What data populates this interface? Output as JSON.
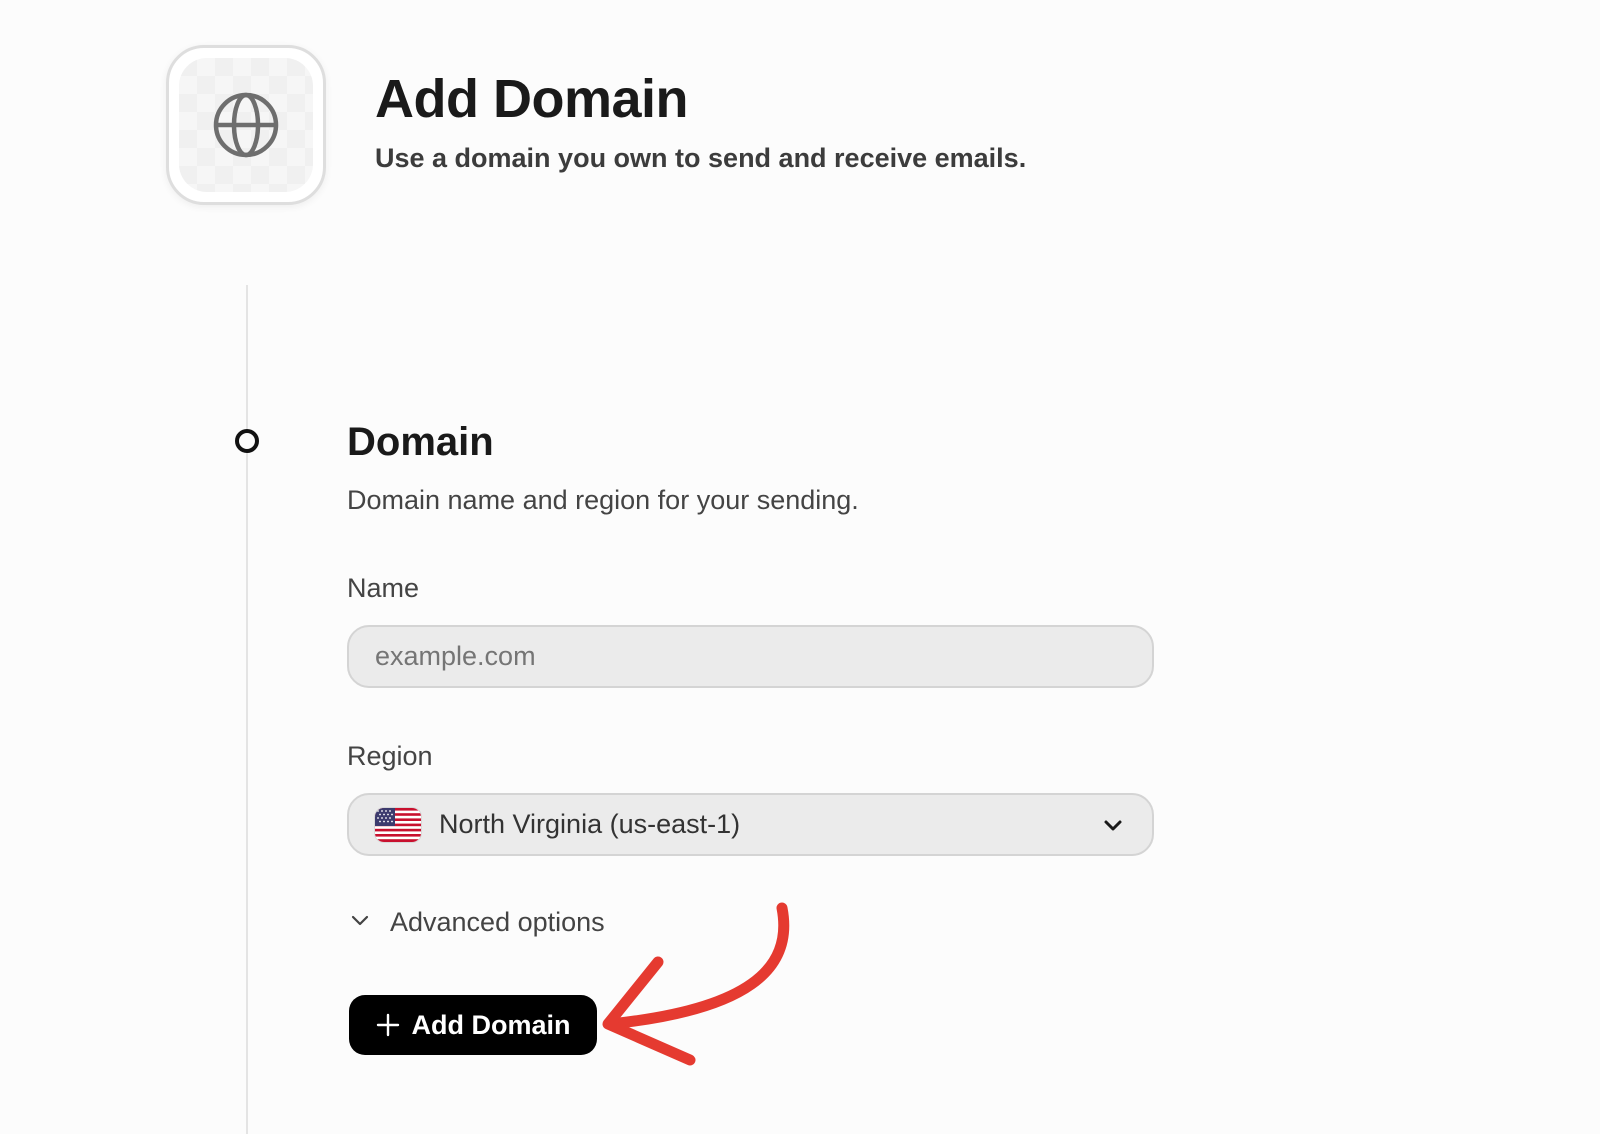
{
  "header": {
    "title": "Add Domain",
    "subtitle": "Use a domain you own to send and receive emails.",
    "icon": "globe-icon"
  },
  "section": {
    "title": "Domain",
    "description": "Domain name and region for your sending."
  },
  "form": {
    "name_label": "Name",
    "name_placeholder": "example.com",
    "name_value": "",
    "region_label": "Region",
    "region_value": "North Virginia (us-east-1)",
    "region_flag": "us-flag-icon",
    "advanced_label": "Advanced options"
  },
  "actions": {
    "add_label": "Add Domain"
  },
  "colors": {
    "accent": "#000000",
    "annotation": "#e53a30",
    "input_bg": "#ebebeb"
  }
}
